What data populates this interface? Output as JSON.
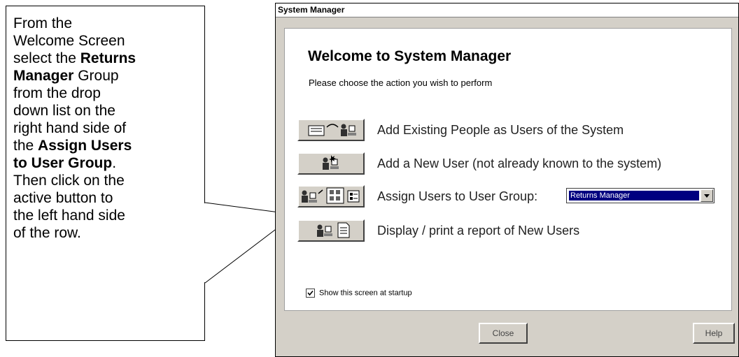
{
  "callout": {
    "line1": "From the",
    "line2": "Welcome Screen",
    "line3_pre": "select the ",
    "line3_bold": "Returns",
    "line4_bold": "Manager",
    "line4_post": " Group",
    "line5": "from the drop",
    "line6": "down list on the",
    "line7": "right hand side of",
    "line8_pre": "the ",
    "line8_bold": "Assign Users",
    "line9_bold": "to User Group",
    "line9_post": ".",
    "line10": "Then click on the",
    "line11": "active button to",
    "line12": "the left hand side",
    "line13": "of the row."
  },
  "window": {
    "title": "System Manager",
    "welcome_title": "Welcome to System Manager",
    "subtitle": "Please choose the action you wish to perform",
    "rows": [
      {
        "label": "Add Existing People as Users of the System"
      },
      {
        "label": "Add a New User (not already  known to the system)"
      },
      {
        "label": "Assign Users to User Group:"
      },
      {
        "label": "Display / print a report of New Users"
      }
    ],
    "group_select": {
      "value": "Returns Manager"
    },
    "startup_checkbox": {
      "label": "Show this screen at startup",
      "checked": true
    },
    "close_label": "Close",
    "help_label": "Help"
  }
}
